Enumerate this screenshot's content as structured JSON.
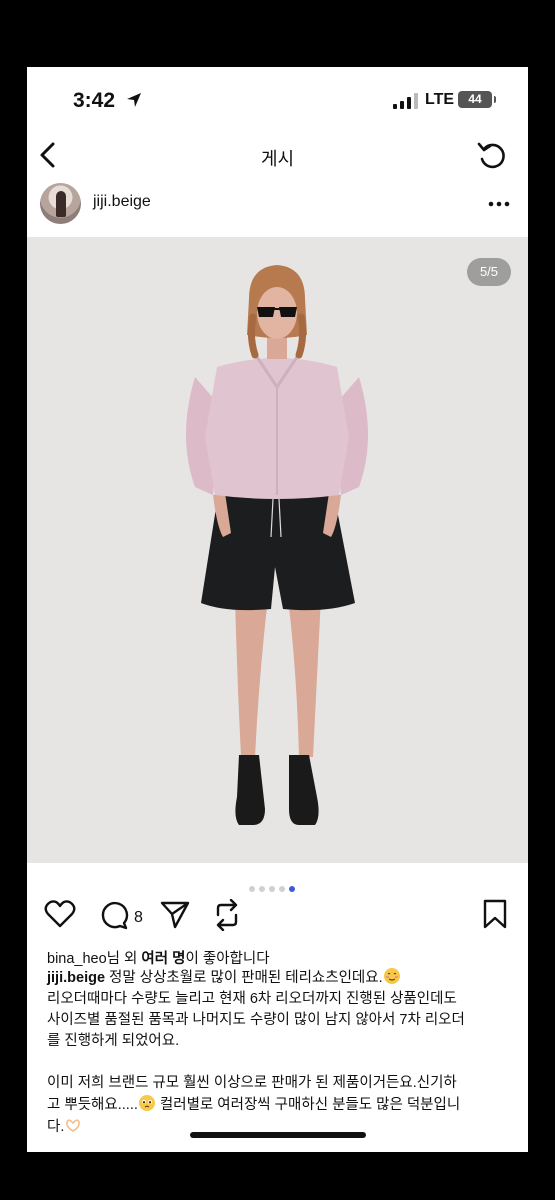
{
  "status_bar": {
    "time": "3:42",
    "network": "LTE",
    "battery": "44"
  },
  "nav": {
    "title": "게시"
  },
  "post": {
    "username": "jiji.beige",
    "photo_counter": "5/5",
    "carousel": {
      "total": 5,
      "active": 5
    },
    "comment_count": "8"
  },
  "likes": {
    "user": "bina_heo",
    "mid": "님 외 ",
    "many": "여러 명",
    "suffix": "이 좋아합니다"
  },
  "caption": {
    "user": "jiji.beige",
    "line1_text": " 정말 상상초월로 많이 판매된 테리쇼츠인데요.",
    "line2": "리오더때마다 수량도 늘리고 현재 6차 리오더까지 진행된 상품인데도",
    "line3": "사이즈별 품절된 품목과 나머지도 수량이 많이 남지 않아서 7차 리오더",
    "line4": "를 진행하게 되었어요.",
    "line5": "이미 저희 브랜드 규모 훨씬 이상으로 판매가 된 제품이거든요.신기하",
    "line6a": "고 뿌듯해요.....",
    "line6b": " 컬러별로 여러장씩 구매하신 분들도 많은 덕분입니",
    "line7": "다."
  },
  "icons": {
    "back": "chevron-left-icon",
    "refresh": "refresh-icon",
    "more": "more-horizontal-icon",
    "like": "heart-icon",
    "comment": "comment-icon",
    "share": "send-icon",
    "repost": "repost-icon",
    "save": "bookmark-icon"
  },
  "colors": {
    "carousel_active": "#3b5bdb",
    "photo_bg": "#e6e5e3"
  }
}
